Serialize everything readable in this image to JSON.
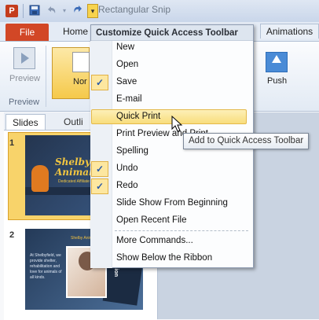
{
  "titlebar": {
    "app_icon_letter": "P",
    "qat_dropdown_arrow": "▾",
    "document_title": "Rectangular Snip",
    "icons": [
      "powerpoint-app-icon",
      "save-icon",
      "undo-icon",
      "redo-icon",
      "customize-qat-dropdown-icon"
    ]
  },
  "ribbon": {
    "tabs": {
      "file": "File",
      "home": "Home",
      "animations": "Animations"
    },
    "preview_label": "Preview",
    "preview_group_label": "Preview",
    "normal_label_fragment": "Nor",
    "push_label": "Push"
  },
  "slides_pane": {
    "tabs": {
      "slides": "Slides",
      "outline": "Outli"
    },
    "slide_numbers": [
      "1",
      "2"
    ],
    "slide1": {
      "title_line1": "Shelbyfi",
      "title_line2": "Animal Res",
      "subtitle": "Dedicated Affiliate"
    },
    "slide2": {
      "body_text": "At Shelbyfield, we provide shelter, rehabilitation and love for animals of all kinds.",
      "side_text": "Mission",
      "caption": "Shelby Animal"
    }
  },
  "qat_menu": {
    "header": "Customize Quick Access Toolbar",
    "items": [
      {
        "label": "New",
        "checked": false
      },
      {
        "label": "Open",
        "checked": false
      },
      {
        "label": "Save",
        "checked": true
      },
      {
        "label": "E-mail",
        "checked": false
      },
      {
        "label": "Quick Print",
        "checked": false,
        "highlighted": true
      },
      {
        "label": "Print Preview and Print",
        "checked": false
      },
      {
        "label": "Spelling",
        "checked": false
      },
      {
        "label": "Undo",
        "checked": true
      },
      {
        "label": "Redo",
        "checked": true
      },
      {
        "label": "Slide Show From Beginning",
        "checked": false
      },
      {
        "label": "Open Recent File",
        "checked": false
      },
      {
        "label": "More Commands...",
        "checked": false
      },
      {
        "label": "Show Below the Ribbon",
        "checked": false
      }
    ],
    "check_glyph": "✓"
  },
  "tooltip": {
    "text": "Add to Quick Access Toolbar"
  },
  "colors": {
    "file_tab": "#d24726",
    "highlight": "#f8dd7c",
    "check_box": "#fde7a0"
  }
}
